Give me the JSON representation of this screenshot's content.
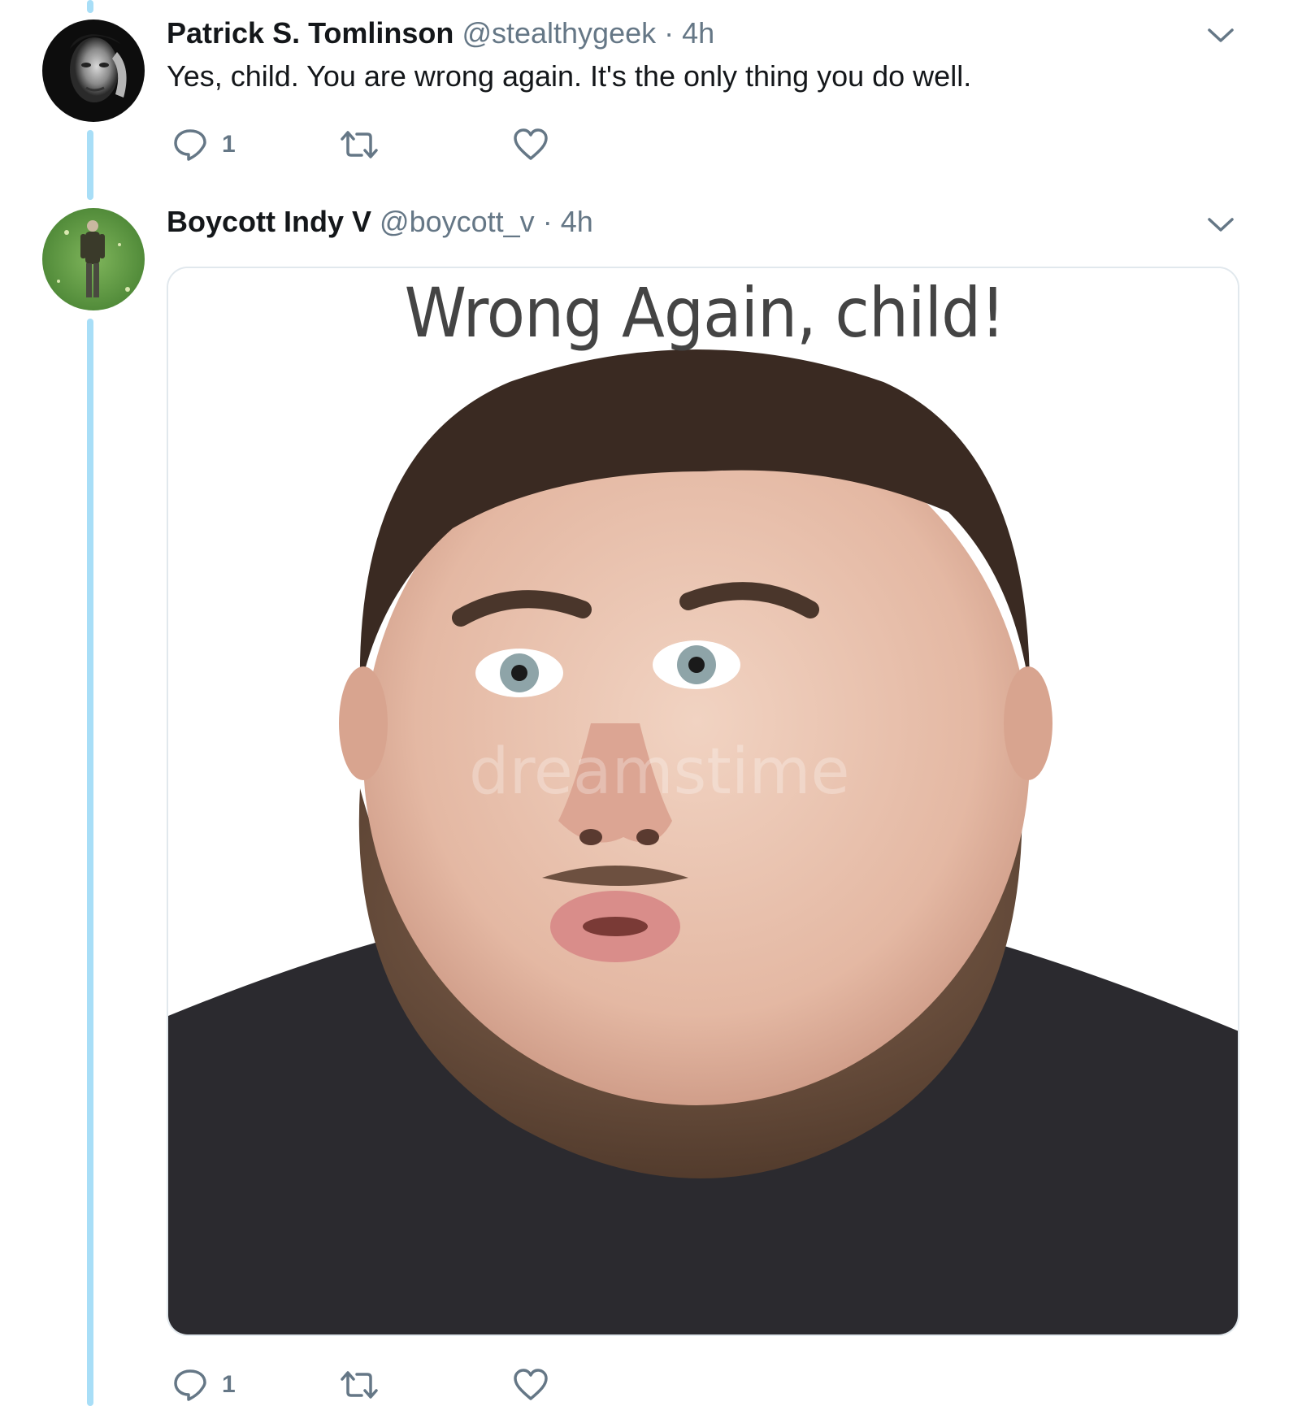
{
  "tweets": [
    {
      "display_name": "Patrick S. Tomlinson",
      "handle": "@stealthygeek",
      "separator": "·",
      "time": "4h",
      "text": "Yes, child. You are wrong again. It's the only thing you do well.",
      "reply_count": "1",
      "retweet_count": "",
      "like_count": ""
    },
    {
      "display_name": "Boycott Indy V",
      "handle": "@boycott_v",
      "separator": "·",
      "time": "4h",
      "media": {
        "caption": "Wrong Again, child!",
        "watermark": "dreamstime"
      },
      "reply_count": "1",
      "retweet_count": "",
      "like_count": ""
    }
  ],
  "colors": {
    "thread_line": "#a8def7",
    "secondary_text": "#657786",
    "primary_text": "#14171a",
    "border": "#e1e8ed"
  }
}
